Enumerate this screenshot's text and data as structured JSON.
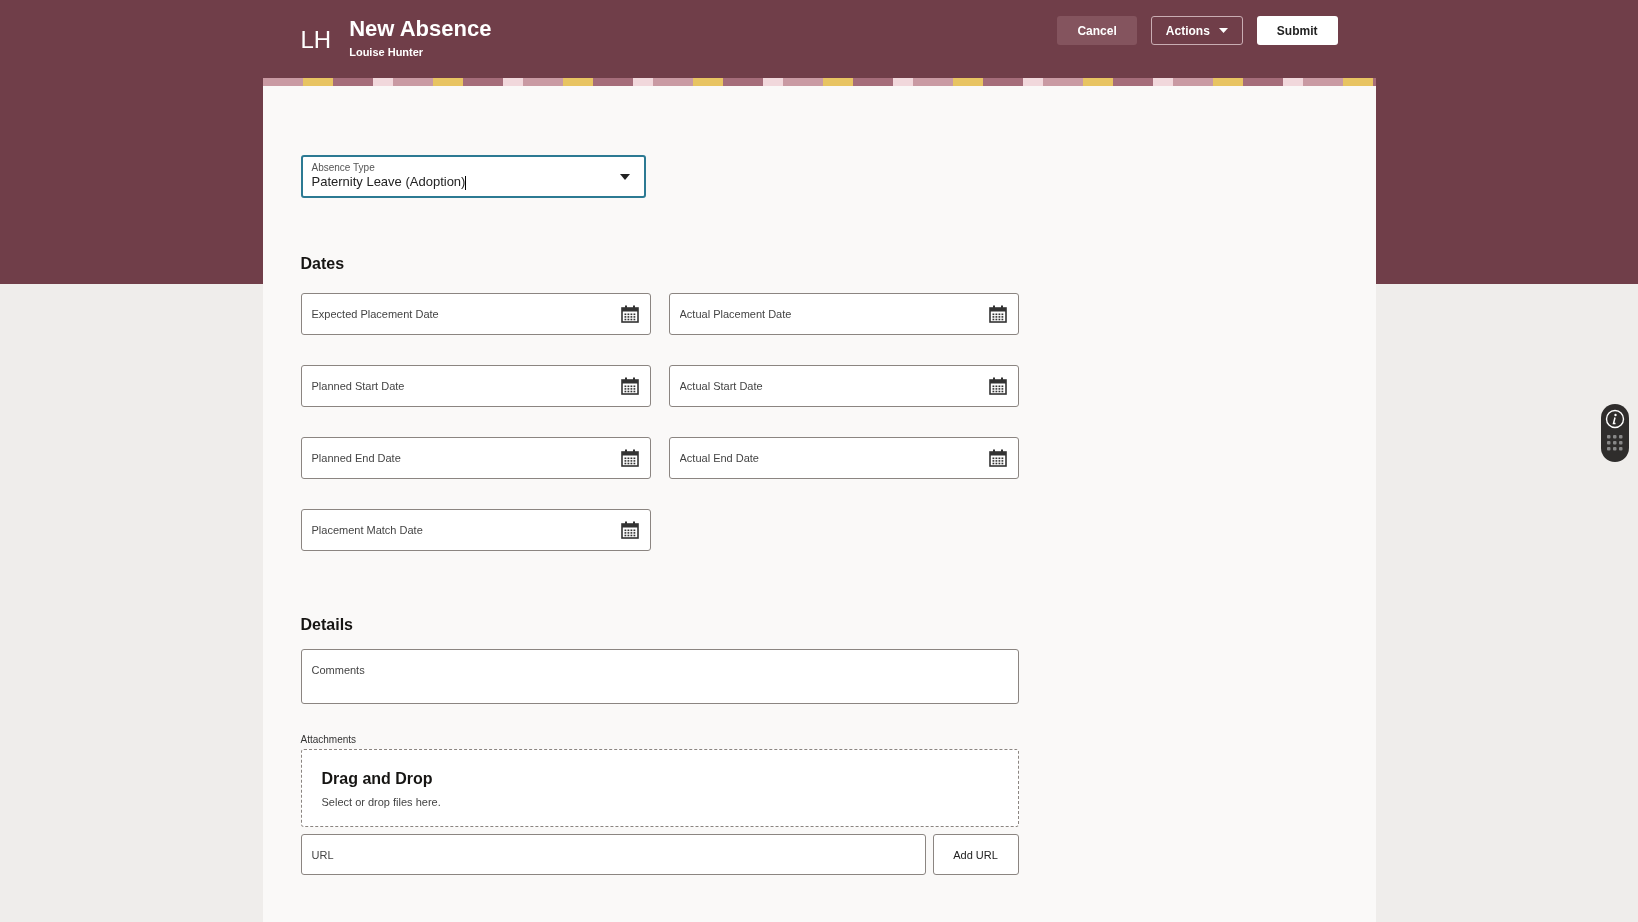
{
  "header": {
    "initials": "LH",
    "title": "New Absence",
    "subtitle": "Louise Hunter"
  },
  "actions": [
    {
      "kind": "cancel",
      "label": "Cancel"
    },
    {
      "kind": "menu",
      "label": "Actions"
    },
    {
      "kind": "primary",
      "label": "Submit"
    }
  ],
  "absence_type": {
    "label": "Absence Type",
    "value": "Paternity Leave (Adoption)"
  },
  "dates": {
    "heading": "Dates",
    "fields": [
      {
        "placeholder": "Expected Placement Date"
      },
      {
        "placeholder": "Actual Placement Date"
      },
      {
        "placeholder": "Planned Start Date"
      },
      {
        "placeholder": "Actual Start Date"
      },
      {
        "placeholder": "Planned End Date"
      },
      {
        "placeholder": "Actual End Date"
      },
      {
        "placeholder": "Placement Match Date"
      }
    ]
  },
  "details": {
    "heading": "Details",
    "comments_placeholder": "Comments",
    "attachments_label": "Attachments",
    "dropzone_title": "Drag and Drop",
    "dropzone_hint": "Select or drop files here.",
    "url_placeholder": "URL",
    "add_url_button": "Add URL"
  }
}
